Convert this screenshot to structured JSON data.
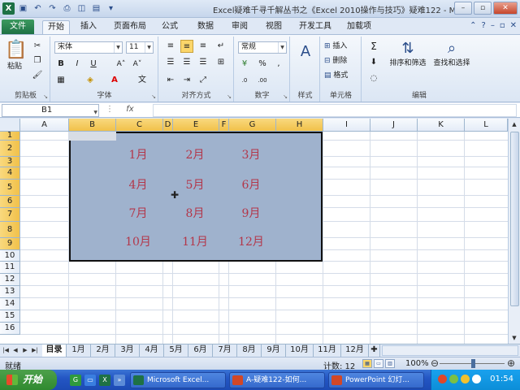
{
  "window": {
    "title": "Excel疑难千寻千解丛书之《Excel 2010操作与技巧》疑难122 - M...",
    "minimize": "–",
    "restore": "▫",
    "close": "✕"
  },
  "qat": [
    "save-icon",
    "undo-icon",
    "redo-icon",
    "print-icon"
  ],
  "tabs": [
    "文件",
    "开始",
    "插入",
    "页面布局",
    "公式",
    "数据",
    "审阅",
    "视图",
    "开发工具",
    "加载项"
  ],
  "ribbon": {
    "clipboard": {
      "paste": "粘贴",
      "label": "剪贴板"
    },
    "font": {
      "name": "宋体",
      "size": "11",
      "bold": "B",
      "italic": "I",
      "underline": "U",
      "label": "字体",
      "grow": "A˄",
      "shrink": "A˅",
      "fill": "A",
      "wen": "文"
    },
    "alignment": {
      "label": "对齐方式"
    },
    "number": {
      "format": "常规",
      "percent": "%",
      "comma": ",",
      "label": "数字"
    },
    "styles": {
      "label": "样式"
    },
    "cells": {
      "insert": "插入",
      "delete": "删除",
      "format": "格式",
      "label": "单元格"
    },
    "editing": {
      "sort": "排序和筛选",
      "find": "查找和选择",
      "label": "编辑",
      "sum": "Σ"
    }
  },
  "formula_bar": {
    "name_box": "B1",
    "fx": "fx",
    "formula": ""
  },
  "columns": [
    "A",
    "B",
    "C",
    "D",
    "E",
    "F",
    "G",
    "H",
    "I",
    "J",
    "K",
    "L"
  ],
  "rows": [
    "1",
    "2",
    "3",
    "4",
    "5",
    "6",
    "7",
    "8",
    "9",
    "10",
    "11",
    "12",
    "13",
    "14",
    "15",
    "16"
  ],
  "months": [
    "1月",
    "2月",
    "3月",
    "4月",
    "5月",
    "6月",
    "7月",
    "8月",
    "9月",
    "10月",
    "11月",
    "12月"
  ],
  "sheets": [
    "目录",
    "1月",
    "2月",
    "3月",
    "4月",
    "5月",
    "6月",
    "7月",
    "8月",
    "9月",
    "10月",
    "11月",
    "12月"
  ],
  "status": {
    "ready": "就绪",
    "count": "计数: 12",
    "zoom": "100%"
  },
  "taskbar": {
    "start": "开始",
    "tasks": [
      "Microsoft Excel...",
      "A-疑难122-如何...",
      "PowerPoint 幻灯..."
    ],
    "clock": "01:54"
  },
  "colors": {
    "selection": "#9fb2cd",
    "month_text": "#b3374a",
    "excel_green": "#1e7145"
  }
}
